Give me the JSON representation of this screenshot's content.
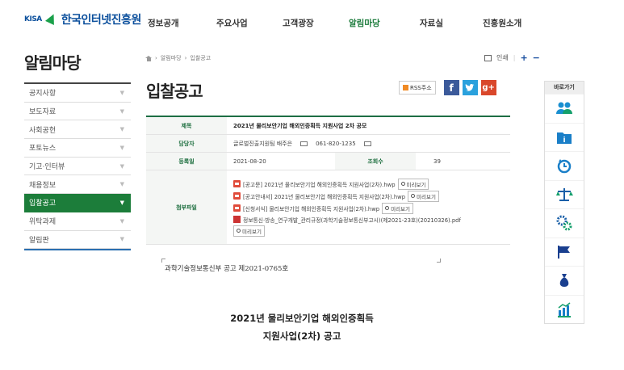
{
  "header": {
    "logo_mark": "KISA",
    "logo_text": "한국인터넷진흥원",
    "nav": [
      "정보공개",
      "주요사업",
      "고객광장",
      "알림마당",
      "자료실",
      "진흥원소개"
    ]
  },
  "sidebar": {
    "title": "알림마당",
    "items": [
      "공지사항",
      "보도자료",
      "사회공헌",
      "포토뉴스",
      "기고·인터뷰",
      "채용정보",
      "입찰공고",
      "위탁과제",
      "알림판"
    ]
  },
  "breadcrumb": [
    "알림마당",
    "입찰공고"
  ],
  "utils": {
    "print": "인쇄",
    "zoom_in": "+",
    "zoom_out": "−"
  },
  "page_title": "입찰공고",
  "share": {
    "rss": "RSS주소",
    "facebook": "f",
    "twitter": "t",
    "googleplus": "g+"
  },
  "detail": {
    "labels": {
      "title": "제목",
      "manager": "담당자",
      "date": "등록일",
      "views": "조회수",
      "files": "첨부파일"
    },
    "title": "2021년 물리보안기업 해외인증획득 지원사업 2차 공모",
    "manager": "글로벌진출지원팀 배주은",
    "phone": "061-820-1235",
    "date": "2021-08-20",
    "views": "39",
    "files": [
      "[공고문] 2021년 물리보안기업 해외인증획득 지원사업(2차).hwp",
      "[공고안내서] 2021년 물리보안기업 해외인증획득 지원사업(2차).hwp",
      "[신청서식] 물리보안기업 해외인증획득 지원사업(2차).hwp",
      "정보통신·방송_연구개발_관리규정(과학기술정보통신부고시)(제2021-23호)(20210326).pdf"
    ],
    "preview_label": "미리보기"
  },
  "body": {
    "notice": "과학기술정보통신부 공고 제2021-0765호",
    "title_line1": "2021년  물리보안기업  해외인증획득",
    "title_line2": "지원사업(2차)  공고"
  },
  "quick": {
    "title": "바로가기",
    "icons": [
      "people-icon",
      "folder-info-icon",
      "clock-icon",
      "scale-icon",
      "gear-icon",
      "flag-icon",
      "bag-icon",
      "bar-chart-icon"
    ]
  },
  "colors": {
    "brand_green": "#1c7d3a",
    "brand_blue": "#0b4f9c",
    "accent_blue": "#2a6fb0"
  }
}
